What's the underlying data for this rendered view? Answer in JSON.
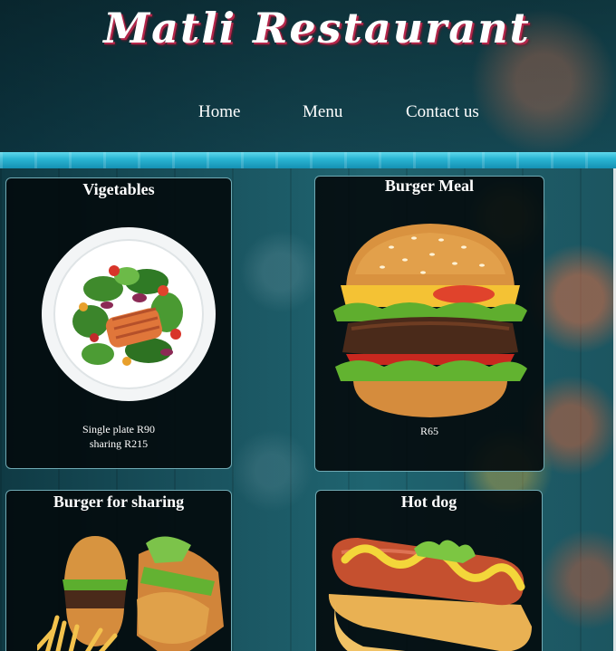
{
  "header": {
    "title": "Matli Restaurant"
  },
  "nav": {
    "items": [
      {
        "label": "Home"
      },
      {
        "label": "Menu"
      },
      {
        "label": "Contact us"
      }
    ]
  },
  "menu": {
    "items": [
      {
        "name": "Vigetables",
        "price_lines": [
          "Single plate R90",
          "sharing R215"
        ],
        "image": "salad-plate-image"
      },
      {
        "name": "Burger Meal",
        "price_lines": [
          "R65"
        ],
        "image": "burger-image"
      },
      {
        "name": "Burger for sharing",
        "price_lines": [],
        "image": "burgers-fries-image"
      },
      {
        "name": "Hot dog",
        "price_lines": [],
        "image": "hotdog-image"
      }
    ]
  },
  "colors": {
    "title_shadow": "#b3264a",
    "card_background": "#030a0c",
    "card_border": "#6fa9b3",
    "stripe": "#2bb6d4"
  }
}
